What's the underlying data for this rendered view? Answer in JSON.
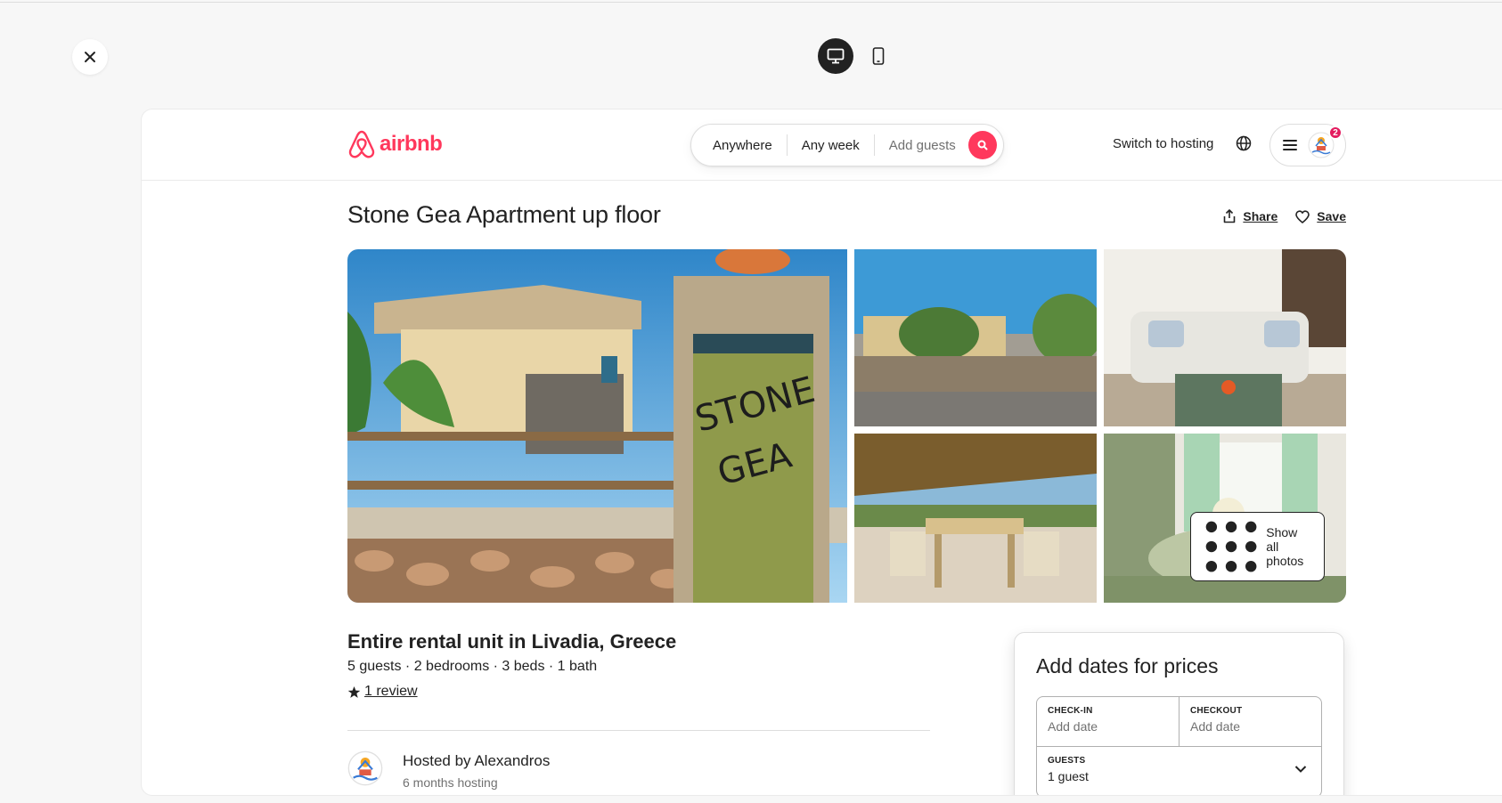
{
  "toolbar": {
    "close_icon": "close-icon",
    "devices": [
      {
        "name": "desktop",
        "icon": "desktop-icon",
        "active": true
      },
      {
        "name": "mobile",
        "icon": "mobile-icon",
        "active": false
      }
    ]
  },
  "header": {
    "logo_text": "airbnb",
    "brand_color": "#FF385C",
    "search": {
      "where": "Anywhere",
      "when": "Any week",
      "who": "Add guests"
    },
    "switch_hosting": "Switch to hosting",
    "notification_count": "2"
  },
  "listing": {
    "title": "Stone Gea Apartment up floor",
    "share_label": "Share",
    "save_label": "Save",
    "show_all_photos": "Show all photos",
    "subtitle": "Entire rental unit in Livadia, Greece",
    "details": "5 guests · 2 bedrooms · 3 beds · 1 bath",
    "reviews": "1 review",
    "host_name": "Hosted by Alexandros",
    "host_since": "6 months hosting"
  },
  "booking": {
    "title": "Add dates for prices",
    "checkin_label": "CHECK-IN",
    "checkin_value": "Add date",
    "checkout_label": "CHECKOUT",
    "checkout_value": "Add date",
    "guests_label": "GUESTS",
    "guests_value": "1 guest"
  }
}
